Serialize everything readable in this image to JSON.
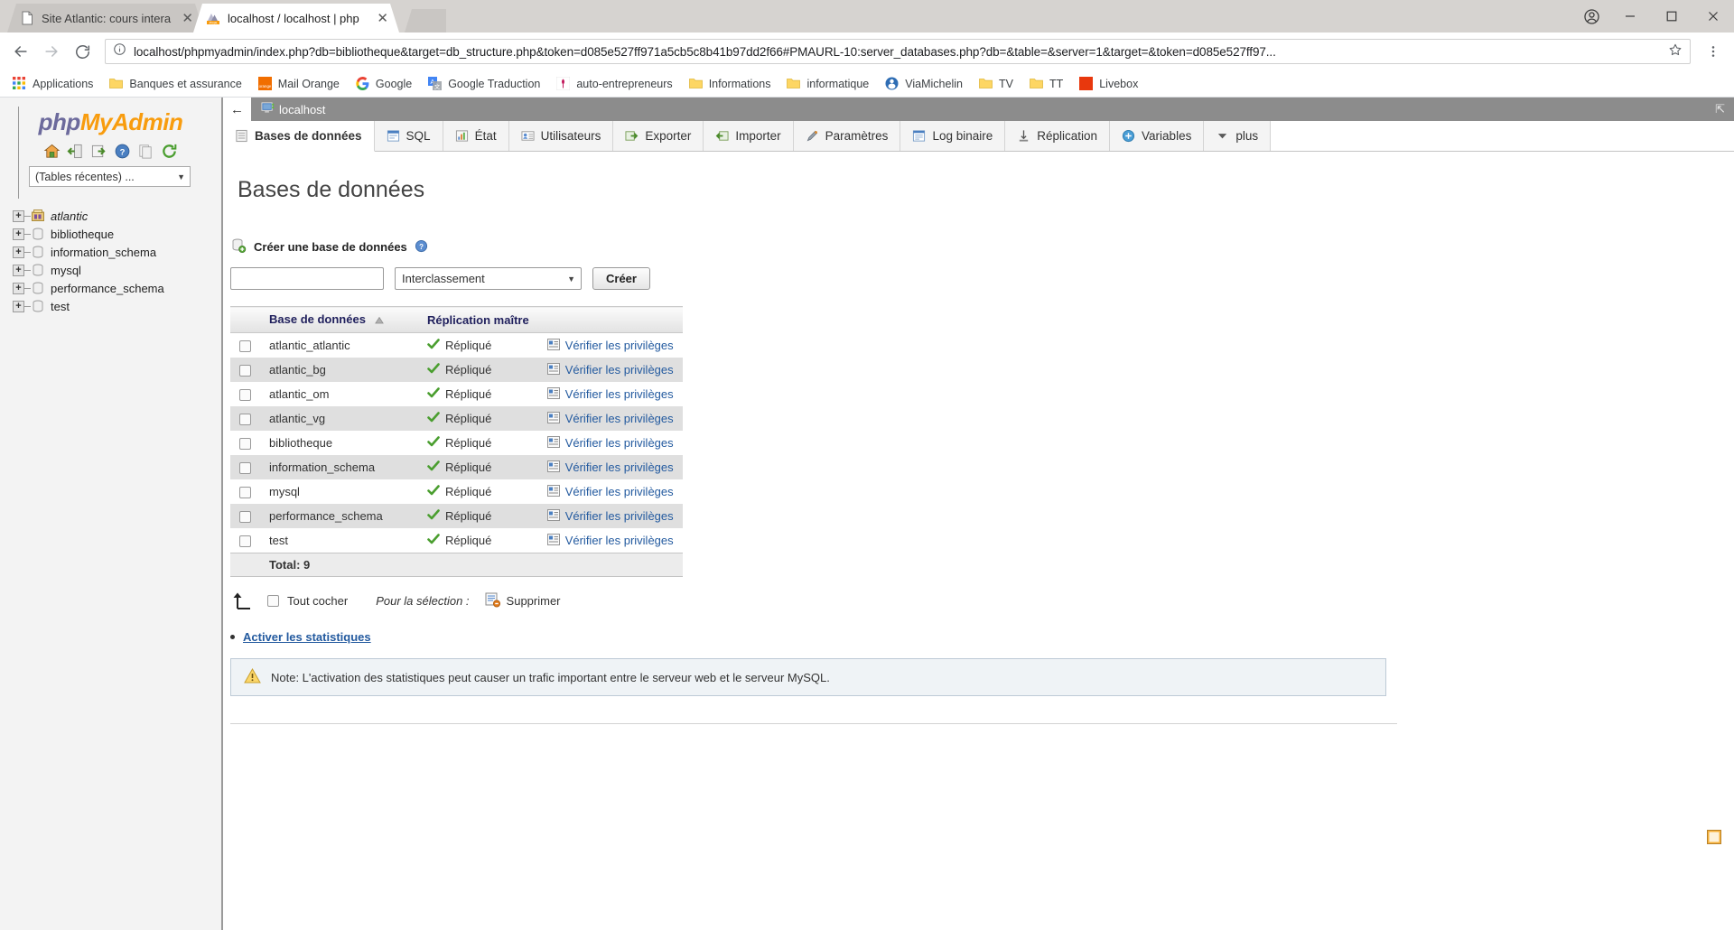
{
  "browser": {
    "tabs": [
      {
        "title": "Site Atlantic: cours intera",
        "favicon": "page-icon",
        "active": false
      },
      {
        "title": "localhost / localhost | php",
        "favicon": "phpmyadmin-icon",
        "active": true
      }
    ],
    "close_glyph": "✕",
    "nav": {
      "back_glyph": "←",
      "forward_glyph": "→",
      "reload_glyph": "↻",
      "url": "localhost/phpmyadmin/index.php?db=bibliotheque&target=db_structure.php&token=d085e527ff971a5cb5c8b41b97dd2f66#PMAURL-10:server_databases.php?db=&table=&server=1&target=&token=d085e527ff97...",
      "info_glyph": "ⓘ",
      "star_glyph": "☆",
      "menu_glyph": "⋮"
    },
    "window": {
      "profile_glyph": "●",
      "minimize_glyph": "—",
      "maximize_glyph": "☐",
      "close_glyph": "✕"
    },
    "bookmarks": [
      {
        "label": "Applications",
        "icon": "apps-grid-icon"
      },
      {
        "label": "Banques et assurance",
        "icon": "folder-icon"
      },
      {
        "label": "Mail Orange",
        "icon": "orange-icon"
      },
      {
        "label": "Google",
        "icon": "google-icon"
      },
      {
        "label": "Google Traduction",
        "icon": "translate-icon"
      },
      {
        "label": "auto-entrepreneurs",
        "icon": "site-icon"
      },
      {
        "label": "Informations",
        "icon": "folder-icon"
      },
      {
        "label": "informatique",
        "icon": "folder-icon"
      },
      {
        "label": "ViaMichelin",
        "icon": "michelin-icon"
      },
      {
        "label": "TV",
        "icon": "folder-icon"
      },
      {
        "label": "TT",
        "icon": "folder-icon"
      },
      {
        "label": "Livebox",
        "icon": "livebox-icon"
      }
    ]
  },
  "sidebar": {
    "logo": {
      "php": "php",
      "my": "My",
      "admin": "Admin"
    },
    "quick_icons": [
      {
        "name": "home-icon"
      },
      {
        "name": "exit-icon"
      },
      {
        "name": "new-window-icon"
      },
      {
        "name": "help-icon"
      },
      {
        "name": "docs-icon"
      },
      {
        "name": "reload-icon"
      }
    ],
    "recent_select": {
      "value": "(Tables récentes) ...",
      "arrow": "▼"
    },
    "databases": [
      {
        "label": "atlantic",
        "icon": "db-structure-icon",
        "italic": true
      },
      {
        "label": "bibliotheque",
        "icon": "db-icon",
        "italic": false
      },
      {
        "label": "information_schema",
        "icon": "db-icon",
        "italic": false
      },
      {
        "label": "mysql",
        "icon": "db-icon",
        "italic": false
      },
      {
        "label": "performance_schema",
        "icon": "db-icon",
        "italic": false
      },
      {
        "label": "test",
        "icon": "db-icon",
        "italic": false
      }
    ],
    "expand_glyph": "+"
  },
  "server_bar": {
    "back_glyph": "←",
    "title": "localhost",
    "collapse_glyph": "⇱"
  },
  "tabs": [
    {
      "label": "Bases de données",
      "icon": "database-icon",
      "active": true
    },
    {
      "label": "SQL",
      "icon": "sql-icon",
      "active": false
    },
    {
      "label": "État",
      "icon": "status-icon",
      "active": false
    },
    {
      "label": "Utilisateurs",
      "icon": "users-icon",
      "active": false
    },
    {
      "label": "Exporter",
      "icon": "export-icon",
      "active": false
    },
    {
      "label": "Importer",
      "icon": "import-icon",
      "active": false
    },
    {
      "label": "Paramètres",
      "icon": "settings-icon",
      "active": false
    },
    {
      "label": "Log binaire",
      "icon": "binlog-icon",
      "active": false
    },
    {
      "label": "Réplication",
      "icon": "replication-icon",
      "active": false
    },
    {
      "label": "Variables",
      "icon": "variables-icon",
      "active": false
    },
    {
      "label": "plus",
      "icon": "chevron-down-icon",
      "active": false
    }
  ],
  "main": {
    "page_title": "Bases de données",
    "create": {
      "section_label": "Créer une base de données",
      "help_glyph": "?",
      "name_value": "",
      "name_placeholder": "",
      "collation_value": "Interclassement",
      "collation_arrow": "▼",
      "button_label": "Créer"
    },
    "table": {
      "headers": {
        "checkbox": "",
        "database": "Base de données",
        "sort_glyph": "▲",
        "replication": "Réplication maître",
        "action": ""
      },
      "rows": [
        {
          "name": "atlantic_atlantic",
          "replication": "Répliqué",
          "action": "Vérifier les privilèges"
        },
        {
          "name": "atlantic_bg",
          "replication": "Répliqué",
          "action": "Vérifier les privilèges"
        },
        {
          "name": "atlantic_om",
          "replication": "Répliqué",
          "action": "Vérifier les privilèges"
        },
        {
          "name": "atlantic_vg",
          "replication": "Répliqué",
          "action": "Vérifier les privilèges"
        },
        {
          "name": "bibliotheque",
          "replication": "Répliqué",
          "action": "Vérifier les privilèges"
        },
        {
          "name": "information_schema",
          "replication": "Répliqué",
          "action": "Vérifier les privilèges"
        },
        {
          "name": "mysql",
          "replication": "Répliqué",
          "action": "Vérifier les privilèges"
        },
        {
          "name": "performance_schema",
          "replication": "Répliqué",
          "action": "Vérifier les privilèges"
        },
        {
          "name": "test",
          "replication": "Répliqué",
          "action": "Vérifier les privilèges"
        }
      ],
      "total_label": "Total: 9"
    },
    "with_selected": {
      "check_all_label": "Tout cocher",
      "for_selection_label": "Pour la sélection :",
      "delete_label": "Supprimer"
    },
    "statistics_link": "Activer les statistiques",
    "note": "Note: L'activation des statistiques peut causer un trafic important entre le serveur web et le serveur MySQL."
  },
  "colors": {
    "pma_orange": "#f89c0e",
    "pma_purple": "#6c6a9c",
    "link_blue": "#235a9f",
    "header_blue": "#1f1f5c",
    "server_gray": "#8c8c8c",
    "row_even": "#dfdfdf",
    "note_bg": "#eff3f6",
    "note_border": "#bdcad6",
    "replicated_green": "#4a9e2f"
  }
}
